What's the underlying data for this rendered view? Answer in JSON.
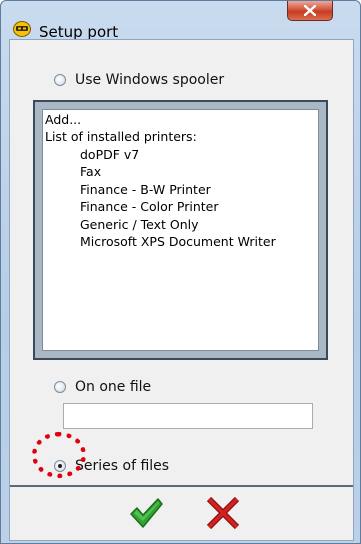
{
  "window": {
    "title": "Setup port",
    "icon": "app-icon",
    "close_icon": "close-icon"
  },
  "options": {
    "use_spooler_label": "Use Windows spooler",
    "one_file_label": "On one file",
    "series_label": "Series of files",
    "selected": "series_of_files"
  },
  "printer_list": {
    "add": "Add...",
    "header": "List of installed printers:",
    "printers": [
      "doPDF v7",
      "Fax",
      "Finance - B-W Printer",
      "Finance - Color Printer",
      "Generic / Text Only",
      "Microsoft XPS Document Writer"
    ]
  },
  "file_input": {
    "value": ""
  },
  "buttons": {
    "ok_icon": "checkmark-icon",
    "cancel_icon": "cancel-x-icon"
  },
  "colors": {
    "ok_green": "#2fa52f",
    "cancel_red": "#d42020",
    "highlight": "#e0000f"
  }
}
